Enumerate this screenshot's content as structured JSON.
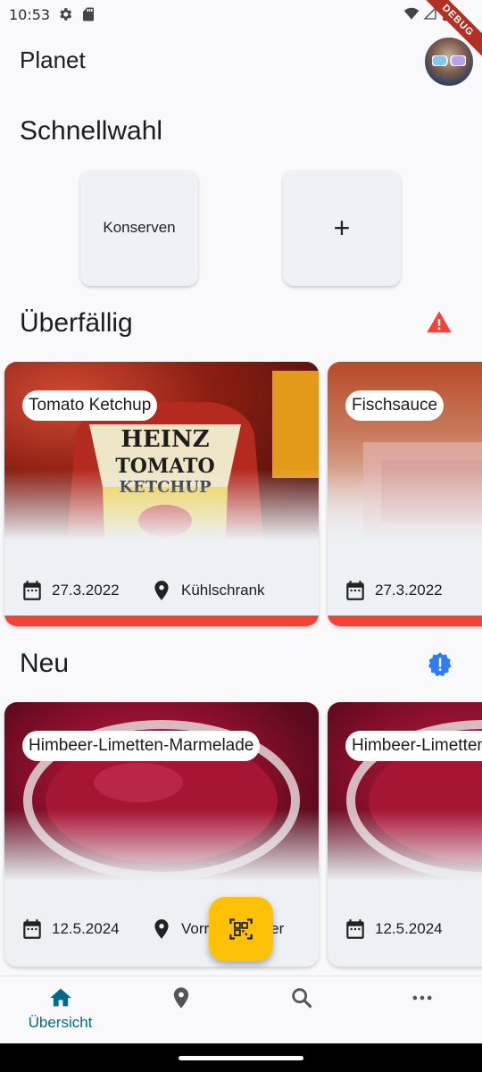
{
  "status_bar": {
    "time": "10:53",
    "debug_label": "DEBUG"
  },
  "app_bar": {
    "title": "Planet"
  },
  "quick_select": {
    "title": "Schnellwahl",
    "tiles": [
      {
        "label": "Konserven"
      },
      {
        "label": "+"
      }
    ]
  },
  "overdue": {
    "title": "Überfällig",
    "icon": "warning-icon",
    "accent_color": "#f44336",
    "cards": [
      {
        "name": "Tomato Ketchup",
        "date": "27.3.2022",
        "location": "Kühlschrank"
      },
      {
        "name": "Fischsauce",
        "date": "27.3.2022",
        "location": ""
      }
    ]
  },
  "new_items": {
    "title": "Neu",
    "icon": "new-badge-icon",
    "accent_color": "#2f7bf5",
    "cards": [
      {
        "name": "Himbeer-Limetten-Marmelade",
        "date": "12.5.2024",
        "location": "Vorratskammer"
      },
      {
        "name": "Himbeer-Limetten-Marmelade",
        "date": "12.5.2024",
        "location": ""
      }
    ]
  },
  "fab": {
    "icon": "qr-scan-icon",
    "color": "#ffc107"
  },
  "bottom_nav": {
    "items": [
      {
        "label": "Übersicht",
        "icon": "home-icon",
        "active": true
      },
      {
        "label": "",
        "icon": "location-pin-icon",
        "active": false
      },
      {
        "label": "",
        "icon": "search-icon",
        "active": false
      },
      {
        "label": "",
        "icon": "more-icon",
        "active": false
      }
    ],
    "active_color": "#006a8a"
  }
}
